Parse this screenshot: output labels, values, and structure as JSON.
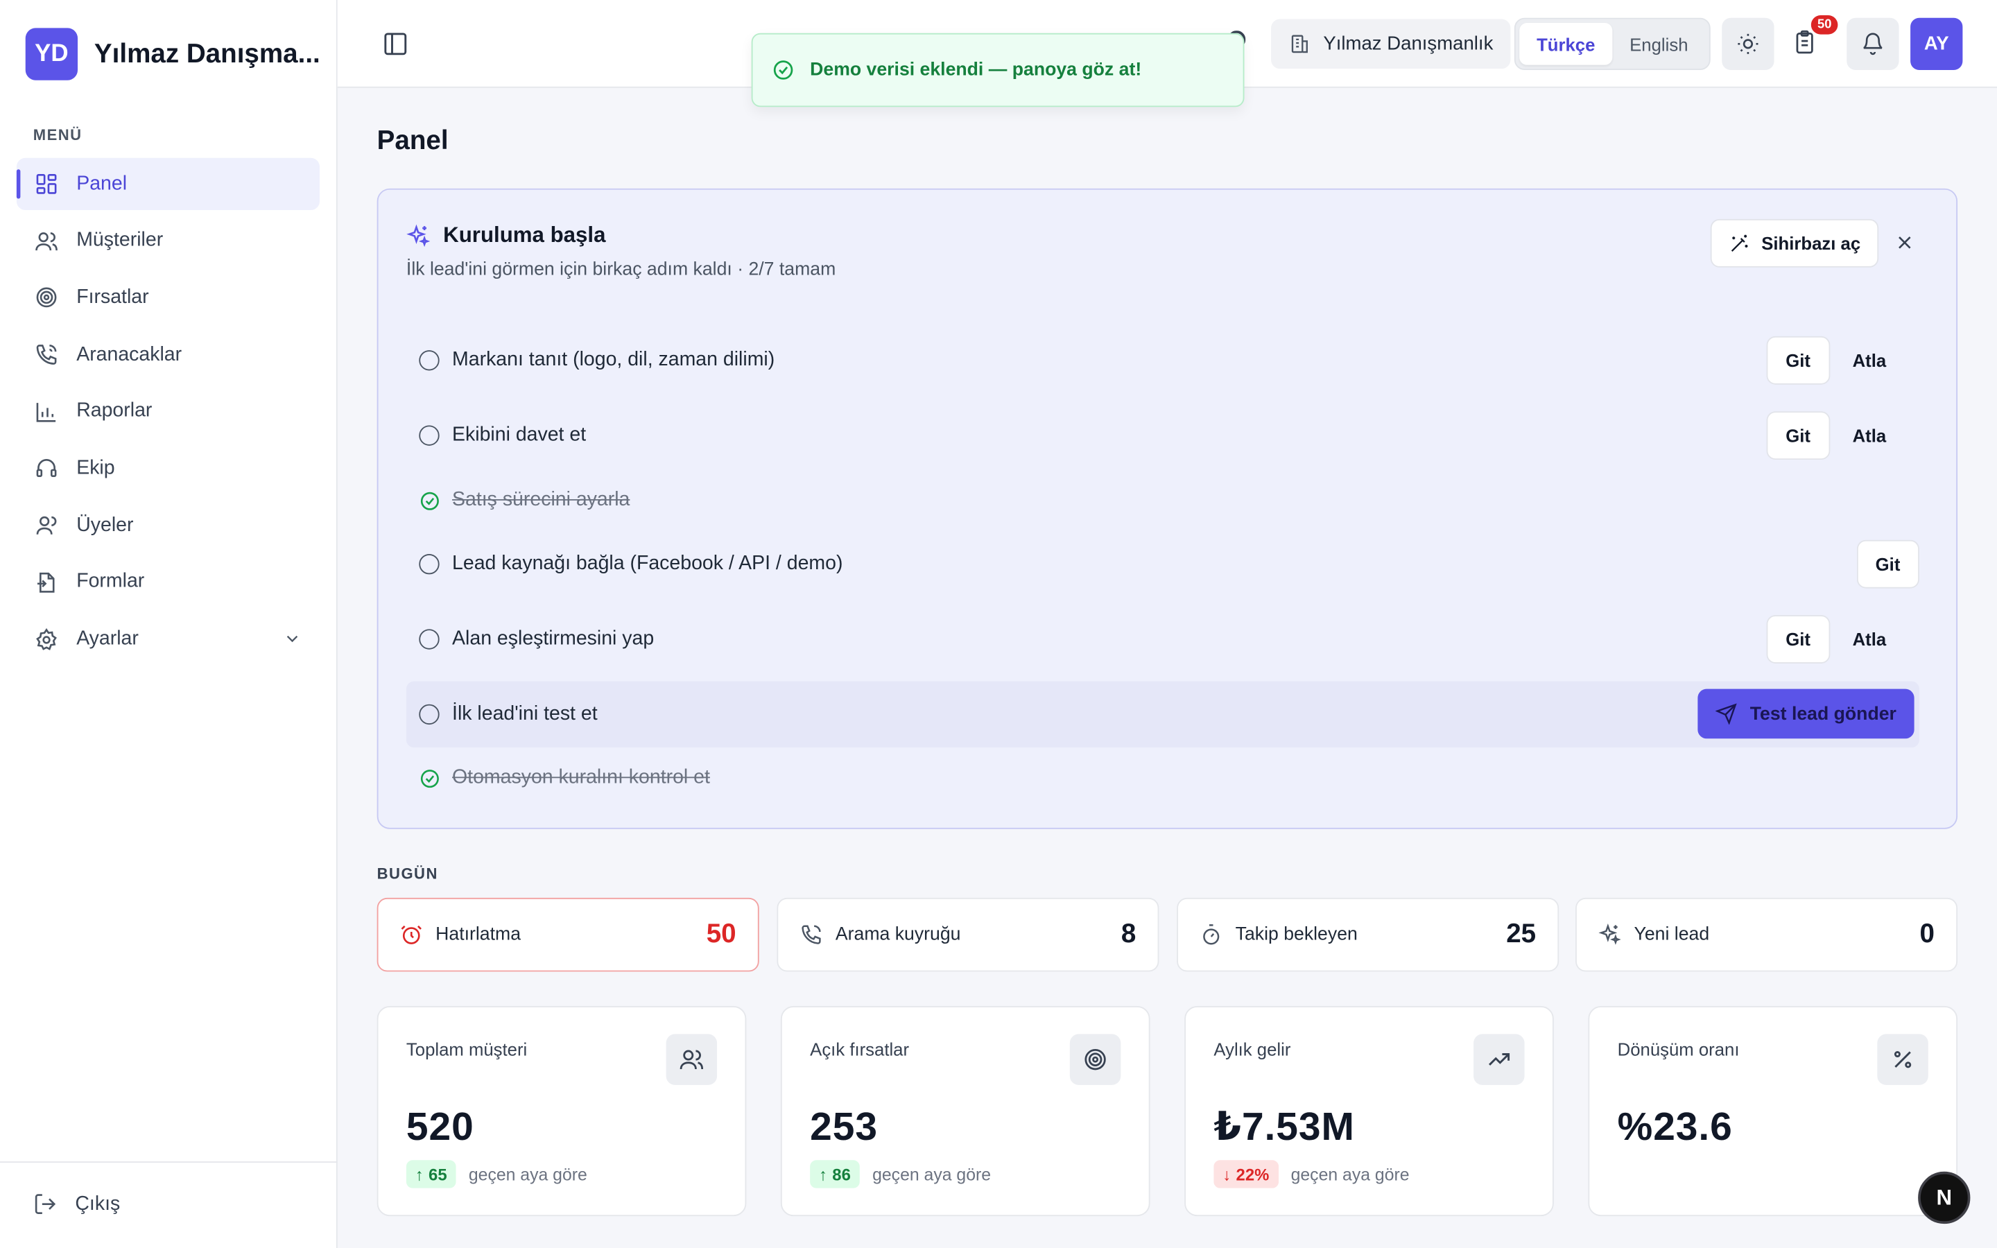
{
  "brand": {
    "logo": "YD",
    "name": "Yılmaz Danışma..."
  },
  "sidebar": {
    "section_label": "MENÜ",
    "items": [
      {
        "label": "Panel",
        "icon": "dashboard-icon",
        "active": true
      },
      {
        "label": "Müşteriler",
        "icon": "users-icon"
      },
      {
        "label": "Fırsatlar",
        "icon": "target-icon"
      },
      {
        "label": "Aranacaklar",
        "icon": "phone-icon"
      },
      {
        "label": "Raporlar",
        "icon": "bar-chart-icon"
      },
      {
        "label": "Ekip",
        "icon": "headset-icon"
      },
      {
        "label": "Üyeler",
        "icon": "user-icon"
      },
      {
        "label": "Formlar",
        "icon": "file-icon"
      },
      {
        "label": "Ayarlar",
        "icon": "gear-icon"
      }
    ],
    "logout": "Çıkış"
  },
  "topbar": {
    "org": "Yılmaz Danışmanlık",
    "lang": [
      "Türkçe",
      "English"
    ],
    "lang_active": "Türkçe",
    "tasks_badge": "50",
    "avatar": "AY"
  },
  "toast": {
    "text": "Demo verisi eklendi — panoya göz at!"
  },
  "page": {
    "title": "Panel"
  },
  "setup": {
    "title": "Kuruluma başla",
    "subtitle": "İlk lead'ini görmen için birkaç adım kaldı · 2/7 tamam",
    "wizard": "Sihirbazı aç",
    "go": "Git",
    "skip": "Atla",
    "steps": [
      {
        "label": "Markanı tanıt (logo, dil, zaman dilimi)",
        "done": false
      },
      {
        "label": "Ekibini davet et",
        "done": false
      },
      {
        "label": "Satış sürecini ayarla",
        "done": true
      },
      {
        "label": "Lead kaynağı bağla (Facebook / API / demo)",
        "done": false
      },
      {
        "label": "Alan eşleştirmesini yap",
        "done": false
      },
      {
        "label": "İlk lead'ini test et",
        "done": false
      },
      {
        "label": "Otomasyon kuralını kontrol et",
        "done": true
      }
    ],
    "test_button": "Test lead gönder"
  },
  "today": {
    "label": "BUGÜN",
    "cards": [
      {
        "label": "Hatırlatma",
        "value": "50"
      },
      {
        "label": "Arama kuyruğu",
        "value": "8"
      },
      {
        "label": "Takip bekleyen",
        "value": "25"
      },
      {
        "label": "Yeni lead",
        "value": "0"
      }
    ]
  },
  "stats": [
    {
      "title": "Toplam müşteri",
      "value": "520",
      "delta": "65",
      "dir": "up",
      "note": "geçen aya göre"
    },
    {
      "title": "Açık fırsatlar",
      "value": "253",
      "delta": "86",
      "dir": "up",
      "note": "geçen aya göre"
    },
    {
      "title": "Aylık gelir",
      "value": "₺7.53M",
      "delta": "22%",
      "dir": "down",
      "note": "geçen aya göre"
    },
    {
      "title": "Dönüşüm oranı",
      "value": "%23.6"
    }
  ],
  "colors": {
    "accent": "#5b54e8",
    "success": "#16a34a",
    "danger": "#dc2626"
  }
}
